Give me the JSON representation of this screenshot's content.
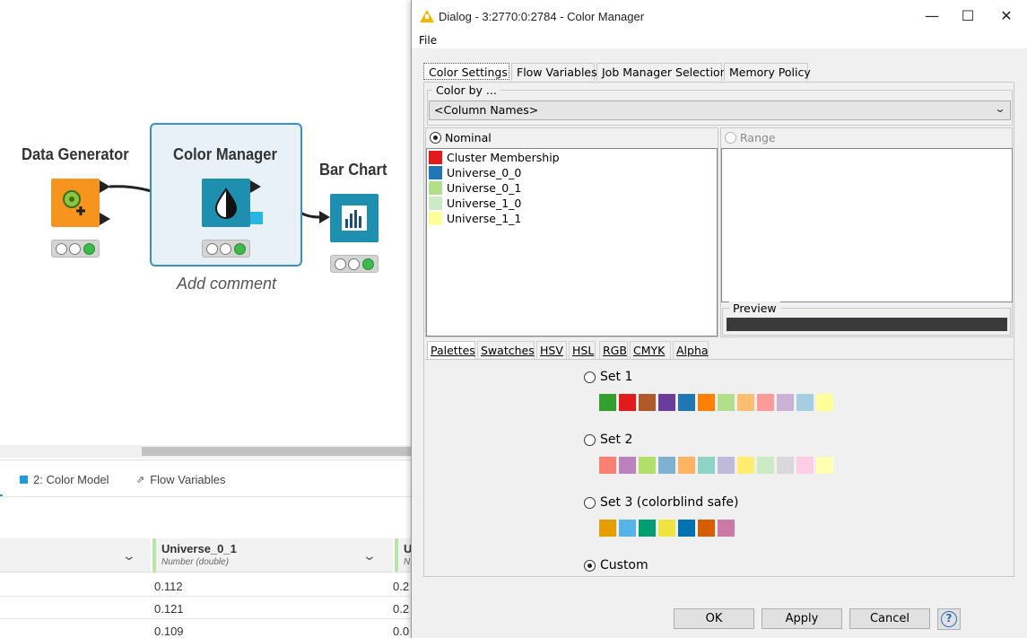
{
  "workflow": {
    "nodes": [
      {
        "title": "Data Generator",
        "icon": "data-generator-icon",
        "color": "#f7941d"
      },
      {
        "title": "Color Manager",
        "icon": "color-manager-icon",
        "color": "#1f8fb0"
      },
      {
        "title": "Bar Chart",
        "icon": "bar-chart-icon",
        "color": "#1f8fb0"
      }
    ],
    "add_comment": "Add comment"
  },
  "bottom_panel": {
    "tabs": [
      "2: Color Model",
      "Flow Variables"
    ],
    "columns": [
      {
        "name": "Universe_0_1",
        "type": "Number (double)"
      },
      {
        "name": "U",
        "type": "N"
      }
    ],
    "rows": [
      [
        "0.112",
        "0.2"
      ],
      [
        "0.121",
        "0.2"
      ],
      [
        "0.109",
        "0.0"
      ]
    ]
  },
  "dialog": {
    "title": "Dialog - 3:2770:0:2784 - Color Manager",
    "menu": [
      "File"
    ],
    "window_buttons": [
      "—",
      "☐",
      "✕"
    ],
    "tabs": [
      "Color Settings",
      "Flow Variables",
      "Job Manager Selection",
      "Memory Policy"
    ],
    "color_by": {
      "label": "Color by ...",
      "value": "<Column Names>"
    },
    "nominal_label": "Nominal",
    "range_label": "Range",
    "preview_label": "Preview",
    "preview_color": "#3a3a3a",
    "nominal_items": [
      {
        "label": "Cluster Membership",
        "color": "#e31a1c"
      },
      {
        "label": "Universe_0_0",
        "color": "#1f78b4"
      },
      {
        "label": "Universe_0_1",
        "color": "#b2df8a"
      },
      {
        "label": "Universe_1_0",
        "color": "#ccebc5"
      },
      {
        "label": "Universe_1_1",
        "color": "#ffff99"
      }
    ],
    "chooser_tabs": [
      "Palettes",
      "Swatches",
      "HSV",
      "HSL",
      "RGB",
      "CMYK",
      "Alpha"
    ],
    "palettes": [
      {
        "label": "Set 1",
        "selected": false,
        "colors": [
          "#33a02c",
          "#e31a1c",
          "#b15928",
          "#6a3d9a",
          "#1f78b4",
          "#ff7f00",
          "#b2df8a",
          "#fdbf6f",
          "#fb9a99",
          "#cab2d6",
          "#a6cee3",
          "#ffff99"
        ]
      },
      {
        "label": "Set 2",
        "selected": false,
        "colors": [
          "#fb8072",
          "#bc80bd",
          "#b3de69",
          "#80b1d3",
          "#fdb462",
          "#8dd3c7",
          "#bebada",
          "#ffed6f",
          "#ccebc5",
          "#d9d9d9",
          "#fccde5",
          "#ffffb3"
        ]
      },
      {
        "label": "Set 3 (colorblind safe)",
        "selected": false,
        "colors": [
          "#e69f00",
          "#56b4e9",
          "#009e73",
          "#f0e442",
          "#0072b2",
          "#d55e00",
          "#cc79a7"
        ]
      },
      {
        "label": "Custom",
        "selected": true,
        "colors": []
      }
    ],
    "buttons": {
      "ok": "OK",
      "apply": "Apply",
      "cancel": "Cancel",
      "help": "?"
    }
  }
}
